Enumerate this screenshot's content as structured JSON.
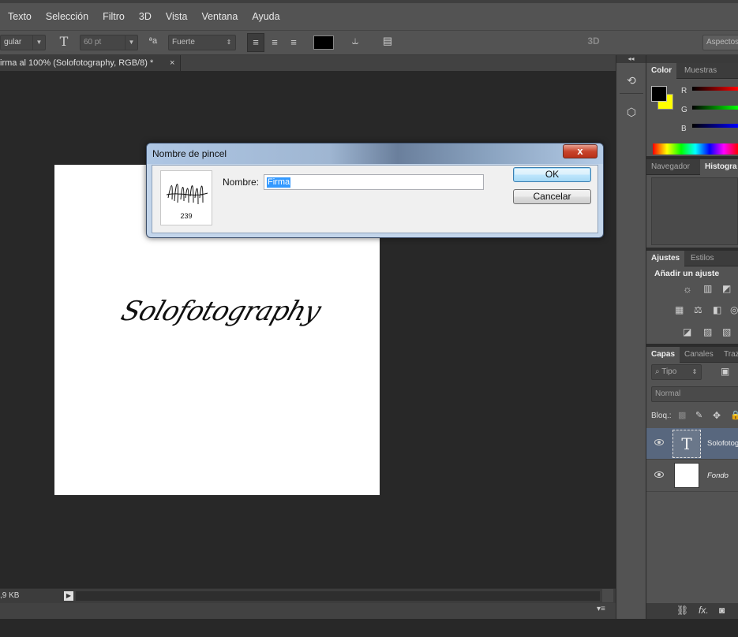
{
  "menu": [
    "Texto",
    "Selección",
    "Filtro",
    "3D",
    "Vista",
    "Ventana",
    "Ayuda"
  ],
  "options": {
    "antialias_partial": "gular",
    "font_size": "60 pt",
    "antialias_mode": "Fuerte",
    "mode_3d": "3D",
    "workspace": "Aspectos"
  },
  "document": {
    "tab_title": "irma al 100% (Solofotography, RGB/8) *",
    "tab_close": "×",
    "canvas_text": "Solofotography",
    "status": ",9 KB"
  },
  "panels": {
    "color_tabs": [
      "Color",
      "Muestras"
    ],
    "channels": [
      "R",
      "G",
      "B"
    ],
    "nav_tabs": [
      "Navegador",
      "Histogra"
    ],
    "adjust_tabs": [
      "Ajustes",
      "Estilos"
    ],
    "adjust_heading": "Añadir un ajuste",
    "layers_tabs": [
      "Capas",
      "Canales",
      "Traz"
    ],
    "layers_filter": "Tipo",
    "blend_mode": "Normal",
    "lock_label": "Bloq.:",
    "layers": [
      {
        "name": "Solofotog",
        "thumb": "T"
      },
      {
        "name": "Fondo",
        "thumb": ""
      }
    ],
    "footer_fx": "fx."
  },
  "dialog": {
    "title": "Nombre de pincel",
    "close": "x",
    "brush_size": "239",
    "name_label": "Nombre:",
    "name_value": "Firma",
    "ok": "OK",
    "cancel": "Cancelar"
  },
  "colors": {
    "foreground": "#000000",
    "background": "#ffff00",
    "ui_dark": "#282828",
    "ui_panel": "#535353"
  }
}
